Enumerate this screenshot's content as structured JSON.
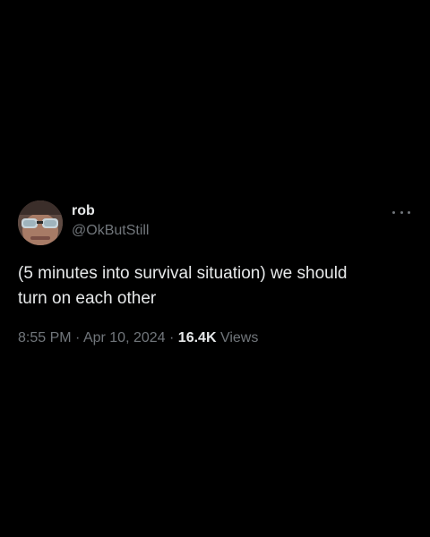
{
  "tweet": {
    "author": {
      "display_name": "rob",
      "handle": "@OkButStill"
    },
    "more_icon": "more-horizontal-icon",
    "text": "(5 minutes into survival situation) we should\nturn on each other",
    "time": "8:55 PM",
    "separator": "·",
    "date": "Apr 10, 2024",
    "views_count": "16.4K",
    "views_label": "Views"
  },
  "colors": {
    "background": "#000000",
    "primary_text": "#e7e9ea",
    "secondary_text": "#71767b"
  }
}
